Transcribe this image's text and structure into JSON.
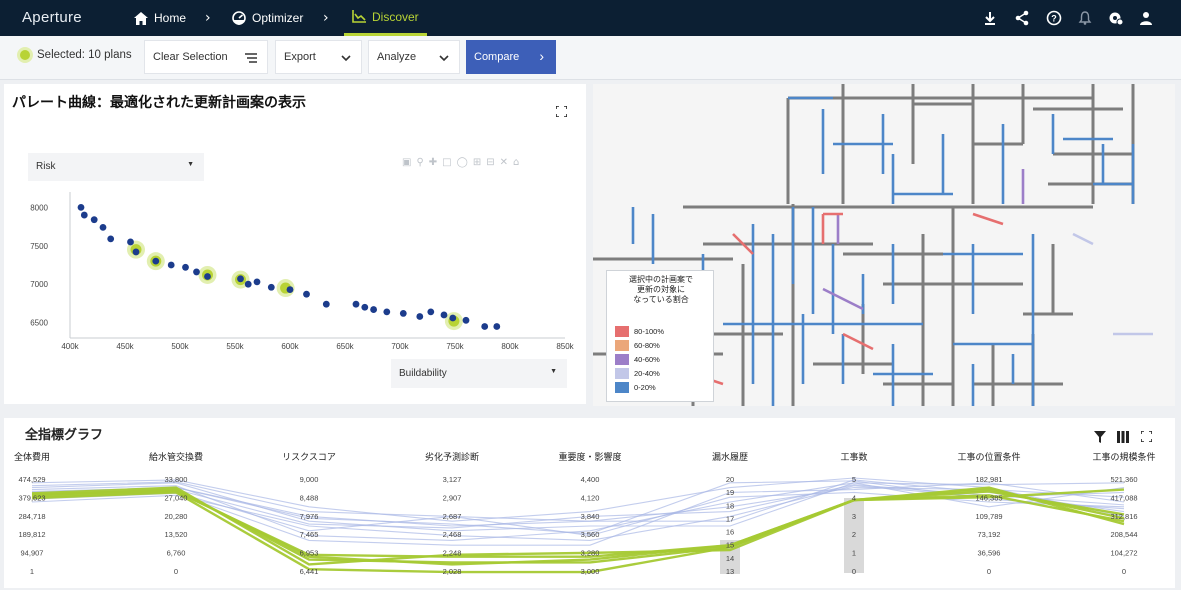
{
  "nav": {
    "logo": "Aperture",
    "crumbs": [
      "Home",
      "Optimizer",
      "Discover"
    ],
    "icons": [
      "download-icon",
      "share-icon",
      "help-icon",
      "bell-icon",
      "settings-icon",
      "user-icon"
    ]
  },
  "toolbar": {
    "selected": "Selected: 10 plans",
    "clear": "Clear Selection",
    "export": "Export",
    "analyze": "Analyze",
    "compare": "Compare"
  },
  "pareto": {
    "title": "パレート曲線：最適化された更新計画案の表示",
    "y_select": "Risk",
    "x_select": "Buildability"
  },
  "chart_data": {
    "type": "scatter",
    "xlabel": "Buildability",
    "ylabel": "Risk",
    "xlim": [
      400000,
      850000
    ],
    "ylim": [
      6300,
      8200
    ],
    "x_ticks": [
      "400k",
      "450k",
      "500k",
      "550k",
      "600k",
      "650k",
      "700k",
      "750k",
      "800k",
      "850k"
    ],
    "y_ticks": [
      "8000",
      "7500",
      "7000",
      "6500"
    ],
    "series": [
      {
        "name": "",
        "points": [
          [
            410000,
            8000
          ],
          [
            413000,
            7900
          ],
          [
            422000,
            7840
          ],
          [
            430000,
            7740
          ],
          [
            437000,
            7590
          ],
          [
            455000,
            7550
          ],
          [
            460000,
            7420
          ],
          [
            478000,
            7300
          ],
          [
            492000,
            7250
          ],
          [
            505000,
            7220
          ],
          [
            515000,
            7160
          ],
          [
            525000,
            7100
          ],
          [
            555000,
            7070
          ],
          [
            562000,
            7000
          ],
          [
            570000,
            7030
          ],
          [
            583000,
            6960
          ],
          [
            600000,
            6930
          ],
          [
            615000,
            6870
          ],
          [
            633000,
            6740
          ],
          [
            660000,
            6740
          ],
          [
            668000,
            6700
          ],
          [
            676000,
            6670
          ],
          [
            688000,
            6640
          ],
          [
            703000,
            6620
          ],
          [
            718000,
            6580
          ],
          [
            728000,
            6640
          ],
          [
            740000,
            6600
          ],
          [
            748000,
            6560
          ],
          [
            760000,
            6530
          ],
          [
            777000,
            6450
          ],
          [
            788000,
            6450
          ]
        ]
      },
      {
        "name": "selected",
        "points": [
          [
            460000,
            7450
          ],
          [
            478000,
            7300
          ],
          [
            525000,
            7120
          ],
          [
            555000,
            7060
          ],
          [
            596000,
            6950
          ],
          [
            749000,
            6520
          ]
        ]
      }
    ]
  },
  "map": {
    "legend_title": "選択中の計画案で\n更新の対象に\nなっている割合",
    "legend": [
      {
        "label": "80-100%",
        "color": "#e66f6f"
      },
      {
        "label": "60-80%",
        "color": "#eba77a"
      },
      {
        "label": "40-60%",
        "color": "#9c7ec8"
      },
      {
        "label": "20-40%",
        "color": "#c2c7e8"
      },
      {
        "label": "0-20%",
        "color": "#4d86c8"
      }
    ]
  },
  "allgraph": {
    "title": "全指標グラフ",
    "axes": [
      {
        "name": "全体費用",
        "ticks": [
          "474,529",
          "379,623",
          "284,718",
          "189,812",
          "94,907",
          "1"
        ]
      },
      {
        "name": "給水管交換費",
        "ticks": [
          "33,800",
          "27,040",
          "20,280",
          "13,520",
          "6,760",
          "0"
        ]
      },
      {
        "name": "リスクスコア",
        "ticks": [
          "9,000",
          "8,488",
          "7,976",
          "7,465",
          "6,953",
          "6,441"
        ]
      },
      {
        "name": "劣化予測診断",
        "ticks": [
          "3,127",
          "2,907",
          "2,687",
          "2,468",
          "2,248",
          "2,028"
        ]
      },
      {
        "name": "重要度・影響度",
        "ticks": [
          "4,400",
          "4,120",
          "3,840",
          "3,560",
          "3,280",
          "3,000"
        ]
      },
      {
        "name": "漏水履歴",
        "ticks": [
          "20",
          "19",
          "18",
          "17",
          "16",
          "15",
          "14",
          "13"
        ]
      },
      {
        "name": "工事数",
        "ticks": [
          "5",
          "4",
          "3",
          "2",
          "1",
          "0"
        ]
      },
      {
        "name": "工事の位置条件",
        "ticks": [
          "182,981",
          "146,385",
          "109,789",
          "73,192",
          "36,596",
          "0"
        ]
      },
      {
        "name": "工事の規模条件",
        "ticks": [
          "521,360",
          "417,088",
          "312,816",
          "208,544",
          "104,272",
          "0"
        ]
      }
    ]
  },
  "colors": {
    "nav": "#0c1f33",
    "accent": "#b8d335",
    "point": "#1c3c8c",
    "compare": "#3d5fb8"
  }
}
